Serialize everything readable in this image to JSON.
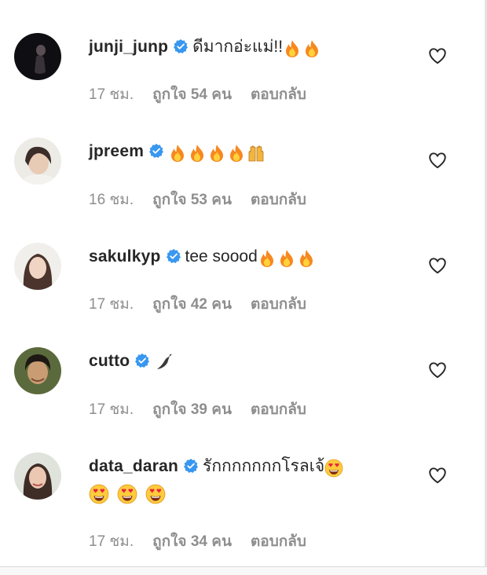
{
  "colors": {
    "accent": "#3897f0",
    "meta": "#8e8e8e",
    "text": "#262626"
  },
  "reply_label": "ตอบกลับ",
  "comments": [
    {
      "username": "junji_junp",
      "text": "ดีมากอ่ะแม่!!",
      "emojis": [
        "fire",
        "fire"
      ],
      "time": "17 ชม.",
      "likes": "ถูกใจ 54 คน"
    },
    {
      "username": "jpreem",
      "text": "",
      "emojis": [
        "fire",
        "fire",
        "fire",
        "fire",
        "raising-hands"
      ],
      "time": "16 ชม.",
      "likes": "ถูกใจ 53 คน"
    },
    {
      "username": "sakulkyp",
      "text": "tee soood",
      "emojis": [
        "fire",
        "fire",
        "fire"
      ],
      "time": "17 ชม.",
      "likes": "ถูกใจ 42 คน"
    },
    {
      "username": "cutto",
      "text": "",
      "emojis": [
        "chili-pepper"
      ],
      "time": "17 ชม.",
      "likes": "ถูกใจ 39 คน"
    },
    {
      "username": "data_daran",
      "text": "รักกกกกกกโรลเจ้",
      "emojis": [
        "heart-eyes"
      ],
      "emojis_line2": [
        "heart-eyes",
        "heart-eyes",
        "heart-eyes"
      ],
      "time": "17 ชม.",
      "likes": "ถูกใจ 34 คน"
    }
  ]
}
